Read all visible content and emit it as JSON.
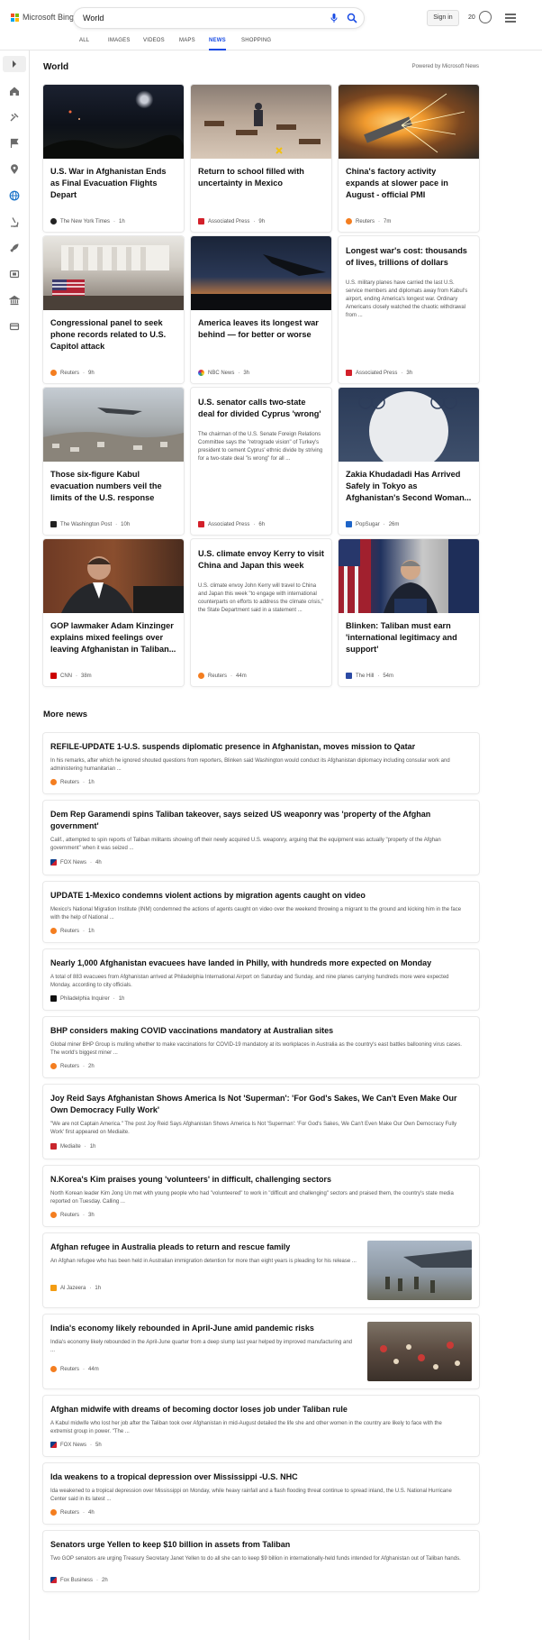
{
  "header": {
    "brand": "Microsoft Bing",
    "search_value": "World",
    "signin_label": "Sign in",
    "points": "20",
    "tabs": [
      "ALL",
      "IMAGES",
      "VIDEOS",
      "MAPS",
      "NEWS",
      "SHOPPING"
    ],
    "active_tab": "NEWS",
    "accent_color": "#174ae4"
  },
  "sidebar": {
    "icons": [
      "expand-arrow-icon",
      "home-icon",
      "tools-icon",
      "flag-icon",
      "location-pin-icon",
      "globe-icon",
      "microscope-icon",
      "rocket-icon",
      "film-icon",
      "bank-icon",
      "card-icon"
    ]
  },
  "world": {
    "title": "World",
    "powered_by": "Powered by Microsoft News",
    "cards": [
      {
        "title": "U.S. War in Afghanistan Ends as Final Evacuation Flights Depart",
        "source": "The New York Times",
        "time": "1h"
      },
      {
        "title": "Return to school filled with uncertainty in Mexico",
        "source": "Associated Press",
        "time": "9h"
      },
      {
        "title": "China's factory activity expands at slower pace in August - official PMI",
        "source": "Reuters",
        "time": "7m"
      },
      {
        "title": "Congressional panel to seek phone records related to U.S. Capitol attack",
        "source": "Reuters",
        "time": "9h"
      },
      {
        "title": "America leaves its longest war behind — for better or worse",
        "source": "NBC News",
        "time": "3h"
      },
      {
        "title": "Longest war's cost: thousands of lives, trillions of dollars",
        "desc": "U.S. military planes have carried the last U.S. service members and diplomats away from Kabul's airport, ending America's longest war. Ordinary Americans closely watched the chaotic withdrawal from ...",
        "source": "Associated Press",
        "time": "3h"
      },
      {
        "title": "Those six-figure Kabul evacuation numbers veil the limits of the U.S. response",
        "source": "The Washington Post",
        "time": "10h"
      },
      {
        "title": "U.S. senator calls two-state deal for divided Cyprus 'wrong'",
        "desc": "The chairman of the U.S. Senate Foreign Relations Committee says the \"retrograde vision\" of Turkey's president to cement Cyprus' ethnic divide by striving for a two-state deal \"is wrong\" for all ...",
        "source": "Associated Press",
        "time": "6h"
      },
      {
        "title": "Zakia Khudadadi Has Arrived Safely in Tokyo as Afghanistan's Second Woman...",
        "source": "PopSugar",
        "time": "26m"
      },
      {
        "title": "GOP lawmaker Adam Kinzinger explains mixed feelings over leaving Afghanistan in Taliban...",
        "source": "CNN",
        "time": "38m"
      },
      {
        "title": "U.S. climate envoy Kerry to visit China and Japan this week",
        "desc": "U.S. climate envoy John Kerry will travel to China and Japan this week \"to engage with international counterparts on efforts to address the climate crisis,\" the State Department said in a statement ...",
        "source": "Reuters",
        "time": "44m"
      },
      {
        "title": "Blinken: Taliban must earn 'international legitimacy and support'",
        "source": "The Hill",
        "time": "54m"
      }
    ]
  },
  "more_news": {
    "title": "More news",
    "items": [
      {
        "title": "REFILE-UPDATE 1-U.S. suspends diplomatic presence in Afghanistan, moves mission to Qatar",
        "desc": "In his remarks, after which he ignored shouted questions from reporters, Blinken said Washington would conduct its Afghanistan diplomacy including consular work and administering humanitarian ...",
        "source": "Reuters",
        "time": "1h"
      },
      {
        "title": "Dem Rep Garamendi spins Taliban takeover, says seized US weaponry was 'property of the Afghan government'",
        "desc": "Calif., attempted to spin reports of Taliban militants showing off their newly acquired U.S. weaponry, arguing that the equipment was actually \"property of the Afghan government\" when it was seized ...",
        "source": "FOX News",
        "time": "4h"
      },
      {
        "title": "UPDATE 1-Mexico condemns violent actions by migration agents caught on video",
        "desc": "Mexico's National Migration Institute (INM) condemned the actions of agents caught on video over the weekend throwing a migrant to the ground and kicking him in the face with the help of National ...",
        "source": "Reuters",
        "time": "1h"
      },
      {
        "title": "Nearly 1,000 Afghanistan evacuees have landed in Philly, with hundreds more expected on Monday",
        "desc": "A total of 883 evacuees from Afghanistan arrived at Philadelphia International Airport on Saturday and Sunday, and nine planes carrying hundreds more were expected Monday, according to city officials.",
        "source": "Philadelphia Inquirer",
        "time": "1h"
      },
      {
        "title": "BHP considers making COVID vaccinations mandatory at Australian sites",
        "desc": "Global miner BHP Group is mulling whether to make vaccinations for COVID-19 mandatory at its workplaces in Australia as the country's east battles ballooning virus cases. The world's biggest miner ...",
        "source": "Reuters",
        "time": "2h"
      },
      {
        "title": "Joy Reid Says Afghanistan Shows America Is Not 'Superman': 'For God's Sakes, We Can't Even Make Our Own Democracy Fully Work'",
        "desc": "\"We are not Captain America.\" The post Joy Reid Says Afghanistan Shows America Is Not 'Superman': 'For God's Sakes, We Can't Even Make Our Own Democracy Fully Work' first appeared on Mediaite.",
        "source": "Mediaite",
        "time": "1h"
      },
      {
        "title": "N.Korea's Kim praises young 'volunteers' in difficult, challenging sectors",
        "desc": "North Korean leader Kim Jong Un met with young people who had \"volunteered\" to work in \"difficult and challenging\" sectors and praised them, the country's state media reported on Tuesday. Calling ...",
        "source": "Reuters",
        "time": "3h"
      },
      {
        "title": "Afghan refugee in Australia pleads to return and rescue family",
        "desc": "An Afghan refugee who has been held in Australian immigration detention for more than eight years is pleading for his release ...",
        "source": "Al Jazeera",
        "time": "1h"
      },
      {
        "title": "India's economy likely rebounded in April-June amid pandemic risks",
        "desc": "India's economy likely rebounded in the April-June quarter from a deep slump last year helped by improved manufacturing and ...",
        "source": "Reuters",
        "time": "44m"
      },
      {
        "title": "Afghan midwife with dreams of becoming doctor loses job under Taliban rule",
        "desc": "A Kabul midwife who lost her job after the Taliban took over Afghanistan in mid-August detailed the life she and other women in the country are likely to face with the extremist group in power. \"The ...",
        "source": "FOX News",
        "time": "5h"
      },
      {
        "title": "Ida weakens to a tropical depression over Mississippi -U.S. NHC",
        "desc": "Ida weakened to a tropical depression over Mississippi on Monday, while heavy rainfall and a flash flooding threat continue to spread inland, the U.S. National Hurricane Center said in its latest ...",
        "source": "Reuters",
        "time": "4h"
      },
      {
        "title": "Senators urge Yellen to keep $10 billion in assets from Taliban",
        "desc": "Two GOP senators are urging Treasury Secretary Janet Yellen to do all she can to keep $9 billion in internationally-held funds intended for Afghanistan out of Taliban hands.",
        "source": "Fox Business",
        "time": "2h"
      }
    ]
  }
}
